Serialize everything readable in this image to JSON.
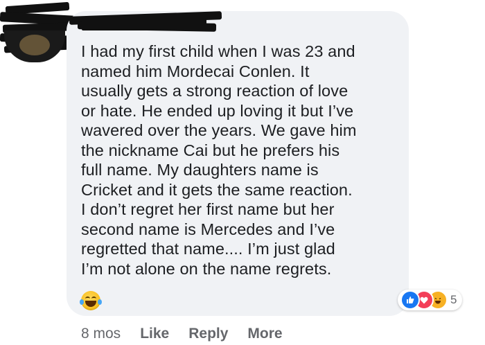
{
  "comment": {
    "text": "I had my first child when I was 23 and\nnamed him Mordecai Conlen. It\nusually gets a strong reaction of love\nor hate. He ended up loving it but I’ve\nwavered over the years. We gave him\nthe nickname Cai but he prefers his\nfull name. My daughters name is\nCricket and it gets the same reaction.\nI don’t regret her first name but her\nsecond name is Mercedes and I’ve\nregretted that name.... I’m just glad\nI’m not alone on the name regrets.",
    "emoji_icon": "laughing-tears-emoji"
  },
  "reactions": {
    "icons": [
      "like-icon",
      "love-icon",
      "haha-icon"
    ],
    "count": "5"
  },
  "actions": {
    "time": "8 mos",
    "like": "Like",
    "reply": "Reply",
    "more": "More"
  },
  "colors": {
    "bubble": "#f0f2f5",
    "text": "#1c1e21",
    "secondary": "#65676b",
    "like": "#1877f2",
    "love": "#f33e58",
    "haha": "#f7b125"
  }
}
